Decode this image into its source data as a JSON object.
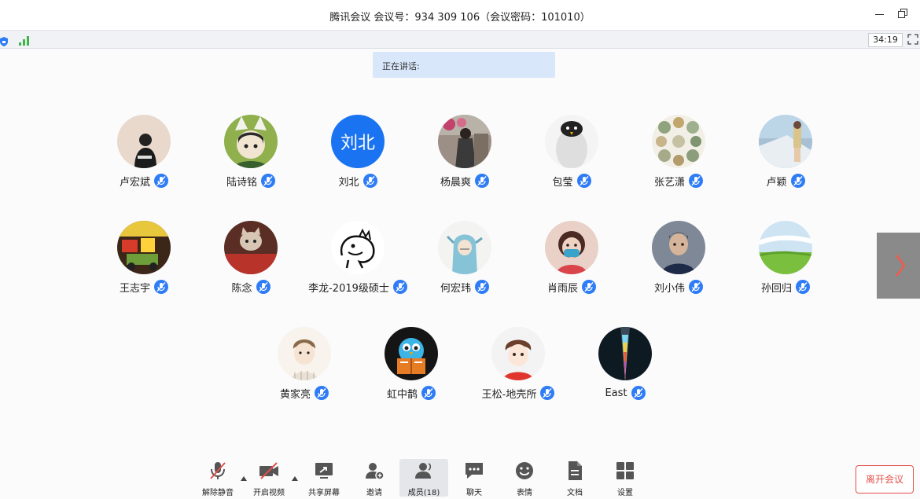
{
  "window": {
    "title": "腾讯会议 会议号：934 309 106（会议密码：101010）"
  },
  "status": {
    "timer": "34:19"
  },
  "speaking": {
    "label": "正在讲话:"
  },
  "participants": [
    {
      "name": "卢宏斌",
      "avatar": "photo-dark-figure"
    },
    {
      "name": "陆诗铭",
      "avatar": "cartoon-character"
    },
    {
      "name": "刘北",
      "avatar_text": "刘北",
      "avatar": "text-avatar"
    },
    {
      "name": "杨晨爽",
      "avatar": "photo-flowers"
    },
    {
      "name": "包莹",
      "avatar": "penguin"
    },
    {
      "name": "张艺潇",
      "avatar": "pattern-circles"
    },
    {
      "name": "卢颖",
      "avatar": "photo-sea"
    },
    {
      "name": "王志宇",
      "avatar": "photo-toys"
    },
    {
      "name": "陈念",
      "avatar": "photo-cat"
    },
    {
      "name": "李龙-2019级硕士",
      "avatar": "sketch-dinosaur"
    },
    {
      "name": "何宏玮",
      "avatar": "cartoon-hoodie"
    },
    {
      "name": "肖雨辰",
      "avatar": "photo-child-mask"
    },
    {
      "name": "刘小伟",
      "avatar": "photo-child"
    },
    {
      "name": "孙回归",
      "avatar": "photo-green-field"
    },
    {
      "name": "黄家亮",
      "avatar": "cartoon-boy"
    },
    {
      "name": "虹中鹊",
      "avatar": "cartoon-bird-reading"
    },
    {
      "name": "王松-地壳所",
      "avatar": "cartoon-boy-red"
    },
    {
      "name": "East",
      "avatar": "dark-rainbow"
    }
  ],
  "toolbar": {
    "unmute": "解除静音",
    "start_video": "开启视频",
    "share_screen": "共享屏幕",
    "invite": "邀请",
    "members": "成员(18)",
    "chat": "聊天",
    "reactions": "表情",
    "docs": "文档",
    "settings": "设置"
  },
  "leave_button": "离开会议",
  "colors": {
    "accent": "#2e7cf6",
    "leave": "#e2504a"
  }
}
